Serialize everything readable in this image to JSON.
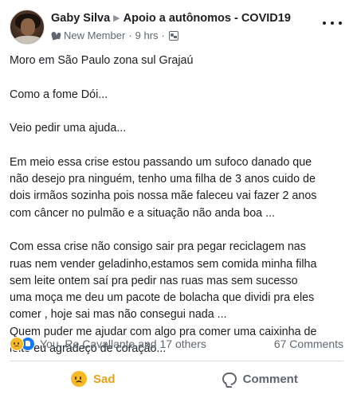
{
  "post": {
    "author": "Gaby Silva",
    "group": "Apoio a autônomos - COVID19",
    "badge": "New Member",
    "time": "9 hrs",
    "paragraphs": [
      [
        "Moro em São Paulo zona sul Grajaú"
      ],
      [
        "Como a fome Dói..."
      ],
      [
        "Veio pedir uma ajuda..."
      ],
      [
        "Em meio essa crise estou passando um sufoco danado que",
        "não desejo pra ninguém, tenho uma filha de 3 anos cuido de",
        "dois irmãos sozinha pois nossa mãe faleceu vai fazer 2 anos",
        "com câncer no pulmão e a situação não anda boa ..."
      ],
      [
        "Com essa crise não consigo sair pra pegar reciclagem nas",
        "ruas nem vender geladinho,estamos sem comida minha filha",
        "sem leite ontem saí pra pedir nas ruas mas sem sucesso",
        "uma moça me deu um pacote de bolacha que dividi pra eles",
        "comer , hoje sai mas não consegui nada ...",
        "Quem puder me ajudar com algo pra comer uma caixinha de",
        "leite eu agradeço de coração..."
      ]
    ]
  },
  "stats": {
    "reactions_text": "You, Re Cavallante and 17 others",
    "comments_text": "67 Comments"
  },
  "actions": {
    "reaction_label": "Sad",
    "comment_label": "Comment"
  },
  "icons": {
    "reaction_primary": "sad-reaction-icon",
    "reaction_secondary": "like-reaction-icon",
    "badge": "new-member-icon",
    "privacy": "group-icon",
    "more": "more-options-icon",
    "comment": "comment-icon"
  },
  "colors": {
    "sad_accent": "#e4a11b",
    "like_blue": "#1877f2",
    "secondary_text": "#606770"
  }
}
